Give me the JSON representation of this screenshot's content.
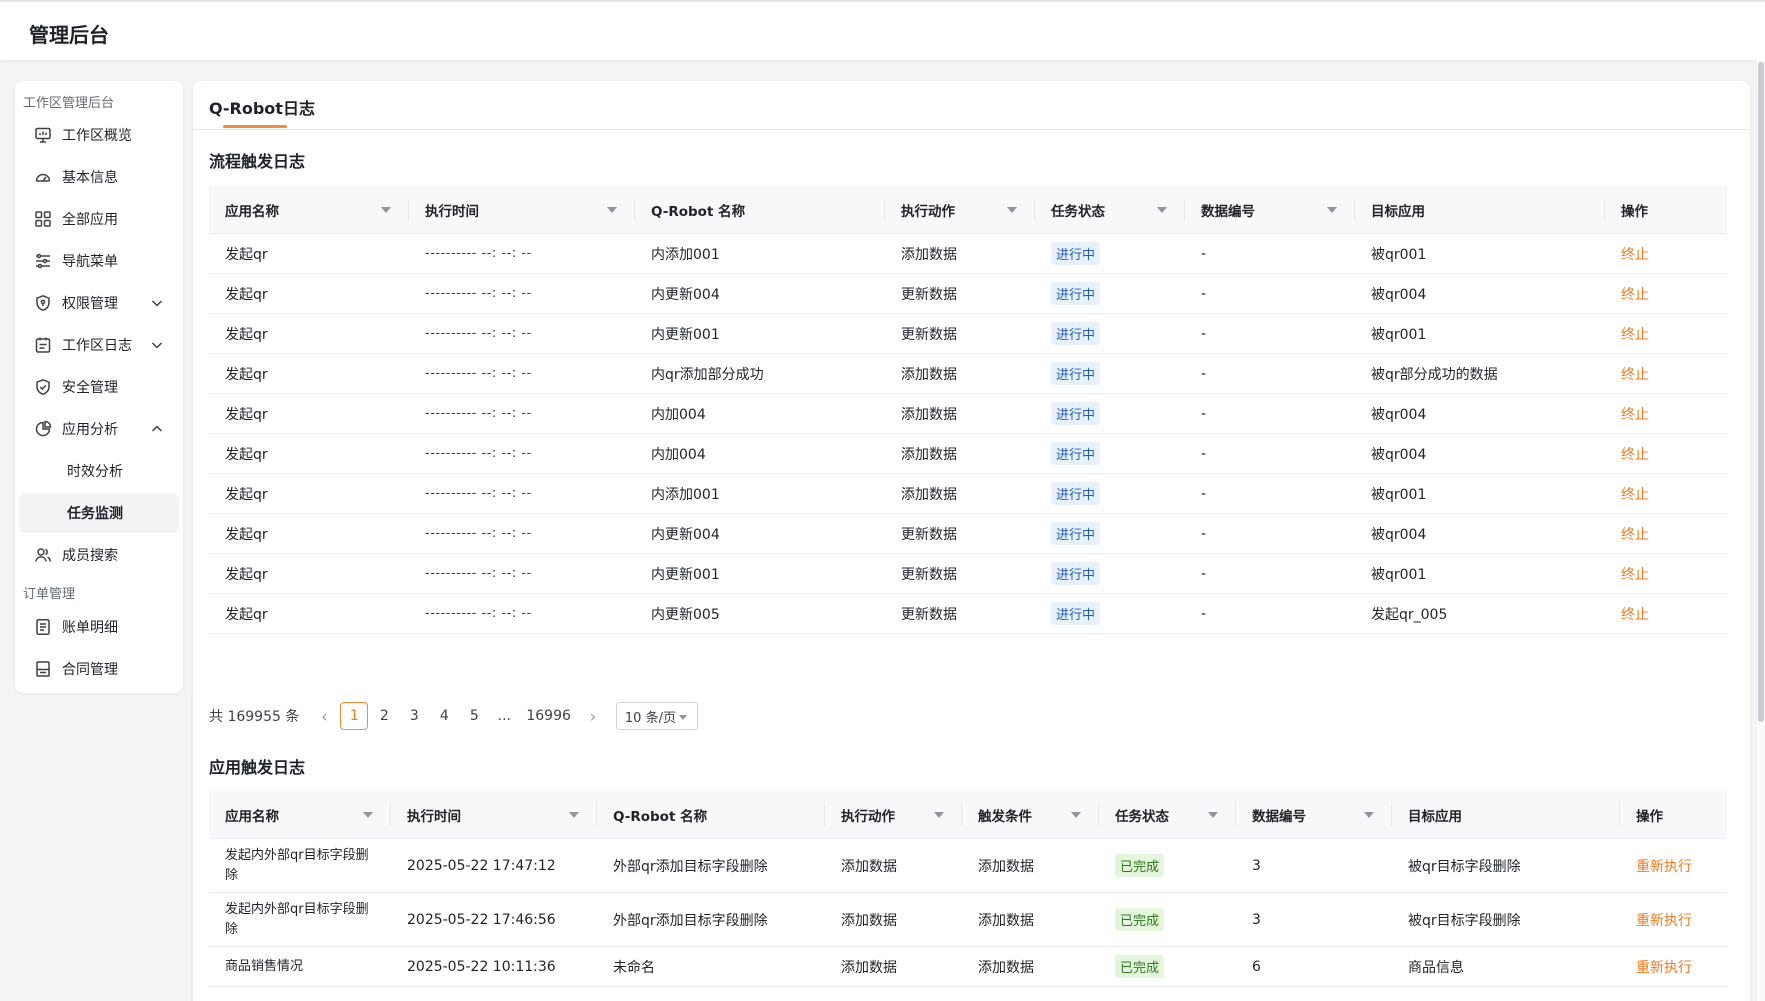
{
  "app": {
    "title": "管理后台"
  },
  "sidebar": {
    "group1": "工作区管理后台",
    "group2": "订单管理",
    "items": [
      {
        "label": "工作区概览",
        "icon": "monitor-icon"
      },
      {
        "label": "基本信息",
        "icon": "dashboard-icon"
      },
      {
        "label": "全部应用",
        "icon": "grid-icon"
      },
      {
        "label": "导航菜单",
        "icon": "sliders-icon"
      },
      {
        "label": "权限管理",
        "icon": "shield-lock-icon"
      },
      {
        "label": "工作区日志",
        "icon": "calendar-icon"
      },
      {
        "label": "安全管理",
        "icon": "shield-check-icon"
      },
      {
        "label": "应用分析",
        "icon": "pie-chart-icon"
      },
      {
        "label": "时效分析"
      },
      {
        "label": "任务监测"
      },
      {
        "label": "成员搜索",
        "icon": "users-icon"
      },
      {
        "label": "账单明细",
        "icon": "bill-icon"
      },
      {
        "label": "合同管理",
        "icon": "contract-icon"
      }
    ]
  },
  "tab": {
    "label": "Q-Robot日志"
  },
  "flow_log": {
    "title": "流程触发日志",
    "headers": [
      "应用名称",
      "执行时间",
      "Q-Robot 名称",
      "执行动作",
      "任务状态",
      "数据编号",
      "目标应用",
      "操作"
    ],
    "rows": [
      {
        "app": "发起qr",
        "time": "---------- --: --: --",
        "robot": "内添加001",
        "action": "添加数据",
        "status": "进行中",
        "num": "-",
        "target": "被qr001",
        "op": "终止"
      },
      {
        "app": "发起qr",
        "time": "---------- --: --: --",
        "robot": "内更新004",
        "action": "更新数据",
        "status": "进行中",
        "num": "-",
        "target": "被qr004",
        "op": "终止"
      },
      {
        "app": "发起qr",
        "time": "---------- --: --: --",
        "robot": "内更新001",
        "action": "更新数据",
        "status": "进行中",
        "num": "-",
        "target": "被qr001",
        "op": "终止"
      },
      {
        "app": "发起qr",
        "time": "---------- --: --: --",
        "robot": "内qr添加部分成功",
        "action": "添加数据",
        "status": "进行中",
        "num": "-",
        "target": "被qr部分成功的数据",
        "op": "终止"
      },
      {
        "app": "发起qr",
        "time": "---------- --: --: --",
        "robot": "内加004",
        "action": "添加数据",
        "status": "进行中",
        "num": "-",
        "target": "被qr004",
        "op": "终止"
      },
      {
        "app": "发起qr",
        "time": "---------- --: --: --",
        "robot": "内加004",
        "action": "添加数据",
        "status": "进行中",
        "num": "-",
        "target": "被qr004",
        "op": "终止"
      },
      {
        "app": "发起qr",
        "time": "---------- --: --: --",
        "robot": "内添加001",
        "action": "添加数据",
        "status": "进行中",
        "num": "-",
        "target": "被qr001",
        "op": "终止"
      },
      {
        "app": "发起qr",
        "time": "---------- --: --: --",
        "robot": "内更新004",
        "action": "更新数据",
        "status": "进行中",
        "num": "-",
        "target": "被qr004",
        "op": "终止"
      },
      {
        "app": "发起qr",
        "time": "---------- --: --: --",
        "robot": "内更新001",
        "action": "更新数据",
        "status": "进行中",
        "num": "-",
        "target": "被qr001",
        "op": "终止"
      },
      {
        "app": "发起qr",
        "time": "---------- --: --: --",
        "robot": "内更新005",
        "action": "更新数据",
        "status": "进行中",
        "num": "-",
        "target": "发起qr_005",
        "op": "终止"
      }
    ]
  },
  "pagination": {
    "total": "共 169955 条",
    "prev": "‹",
    "pages": [
      "1",
      "2",
      "3",
      "4",
      "5",
      "...",
      "16996"
    ],
    "next": "›",
    "size": "10 条/页"
  },
  "app_log": {
    "title": "应用触发日志",
    "headers": [
      "应用名称",
      "执行时间",
      "Q-Robot 名称",
      "执行动作",
      "触发条件",
      "任务状态",
      "数据编号",
      "目标应用",
      "操作"
    ],
    "rows": [
      {
        "app": "发起内外部qr目标字段删除",
        "time": "2025-05-22 17:47:12",
        "robot": "外部qr添加目标字段删除",
        "action": "添加数据",
        "trigger": "添加数据",
        "status": "已完成",
        "num": "3",
        "target": "被qr目标字段删除",
        "op": "重新执行"
      },
      {
        "app": "发起内外部qr目标字段删除",
        "time": "2025-05-22 17:46:56",
        "robot": "外部qr添加目标字段删除",
        "action": "添加数据",
        "trigger": "添加数据",
        "status": "已完成",
        "num": "3",
        "target": "被qr目标字段删除",
        "op": "重新执行"
      },
      {
        "app": "商品销售情况",
        "time": "2025-05-22 10:11:36",
        "robot": "未命名",
        "action": "添加数据",
        "trigger": "添加数据",
        "status": "已完成",
        "num": "6",
        "target": "商品信息",
        "op": "重新执行"
      }
    ]
  },
  "colors": {
    "accent": "#f47b20",
    "badge_blue": "#e8f2ff",
    "badge_green": "#e4f7dc"
  }
}
